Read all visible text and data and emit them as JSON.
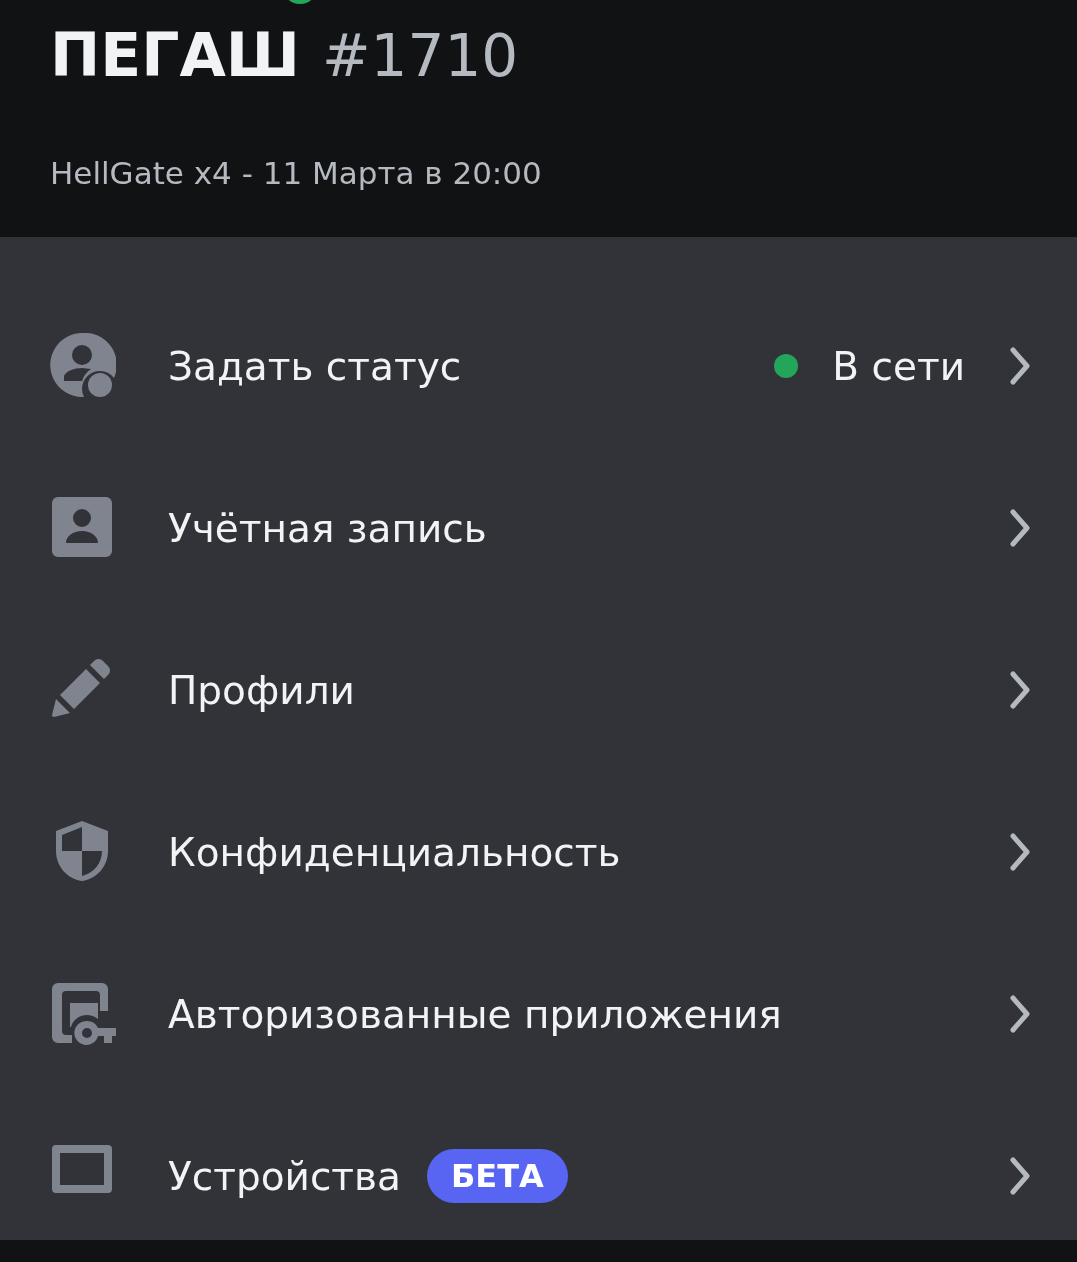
{
  "profile": {
    "online": true,
    "name": "ПЕГАШ",
    "tag": "#1710",
    "subtitle": "HellGate x4 - 11 Марта в 20:00"
  },
  "items": [
    {
      "kind": "status",
      "label": "Задать статус",
      "status": {
        "label": "В сети",
        "color": "#23a55a"
      }
    },
    {
      "kind": "account",
      "label": "Учётная запись"
    },
    {
      "kind": "profiles",
      "label": "Профили"
    },
    {
      "kind": "privacy",
      "label": "Конфиденциальность"
    },
    {
      "kind": "apps",
      "label": "Авторизованные приложения"
    },
    {
      "kind": "devices",
      "label": "Устройства",
      "badge": "БЕТА"
    }
  ]
}
